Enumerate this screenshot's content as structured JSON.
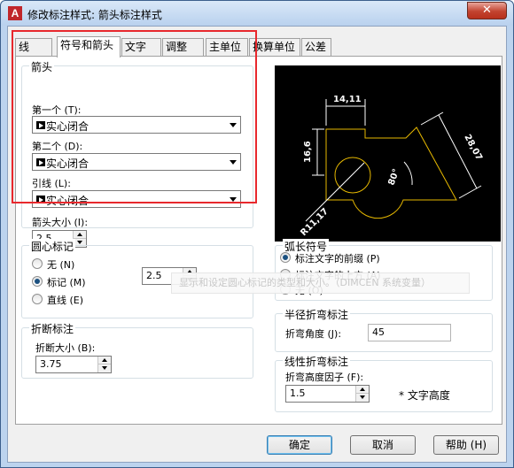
{
  "window": {
    "title": "修改标注样式: 箭头标注样式",
    "close_glyph": "✕"
  },
  "tabs": [
    {
      "label": "线"
    },
    {
      "label": "符号和箭头"
    },
    {
      "label": "文字"
    },
    {
      "label": "调整"
    },
    {
      "label": "主单位"
    },
    {
      "label": "换算单位"
    },
    {
      "label": "公差"
    }
  ],
  "arrowheads": {
    "group_label": "箭头",
    "first_label": "第一个 (T):",
    "first_value": "实心闭合",
    "second_label": "第二个 (D):",
    "second_value": "实心闭合",
    "leader_label": "引线 (L):",
    "leader_value": "实心闭合",
    "size_label": "箭头大小 (I):",
    "size_value": "2.5"
  },
  "center_mark": {
    "group_label": "圆心标记",
    "none_label": "无 (N)",
    "mark_label": "标记 (M)",
    "line_label": "直线 (E)",
    "selected": "mark",
    "size_value": "2.5"
  },
  "dim_break": {
    "group_label": "折断标注",
    "size_label": "折断大小 (B):",
    "size_value": "3.75"
  },
  "arc_length": {
    "group_label": "弧长符号",
    "prefix_label": "标注文字的前缀 (P)",
    "above_label": "标注文字的上方 (A)",
    "none_label": "无 (O)",
    "selected": "prefix"
  },
  "radius_jog": {
    "group_label": "半径折弯标注",
    "angle_label": "折弯角度 (J):",
    "angle_value": "45"
  },
  "linear_jog": {
    "group_label": "线性折弯标注",
    "height_label": "折弯高度因子 (F):",
    "height_value": "1.5",
    "unit_label": "* 文字高度"
  },
  "tooltip": {
    "text": "显示和设定圆心标记的类型和大小。（DIMCEN 系统变量）"
  },
  "preview": {
    "dim_top": "14,11",
    "dim_left": "16,6",
    "dim_right": "28,07",
    "dim_angle": "80°",
    "dim_radius": "R11,17",
    "line_color": "#e6b800",
    "dim_color": "#ffffff"
  },
  "buttons": {
    "ok": "确定",
    "cancel": "取消",
    "help": "帮助 (H)"
  },
  "colors": {
    "highlight_box": "#e8282d"
  }
}
